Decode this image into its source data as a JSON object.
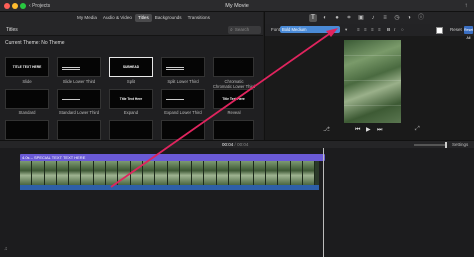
{
  "window": {
    "title": "My Movie",
    "projects_label": "Projects"
  },
  "browser": {
    "tabs": [
      {
        "label": "My Media"
      },
      {
        "label": "Audio & Video"
      },
      {
        "label": "Titles"
      },
      {
        "label": "Backgrounds"
      },
      {
        "label": "Transitions"
      }
    ],
    "active_tab": "Titles",
    "section_label": "Titles",
    "search_placeholder": "Search",
    "theme_label": "Current Theme: No Theme",
    "titles": [
      {
        "caption": "Slide",
        "thumb_text": "TITLE TEXT HERE"
      },
      {
        "caption": "Slide Lower Third",
        "thumb_text": ""
      },
      {
        "caption": "Split",
        "thumb_text": "SUBHEAD"
      },
      {
        "caption": "Split Lower Third",
        "thumb_text": ""
      },
      {
        "caption": "Chromatic",
        "thumb_text": ""
      },
      {
        "caption": "Chromatic Lower Third",
        "thumb_text": ""
      },
      {
        "caption": "Standard",
        "thumb_text": ""
      },
      {
        "caption": "Standard Lower Third",
        "thumb_text": ""
      },
      {
        "caption": "Expand",
        "thumb_text": "Title Text Here"
      },
      {
        "caption": "Expand Lower Third",
        "thumb_text": ""
      },
      {
        "caption": "Reveal",
        "thumb_text": "Title Text Here"
      },
      {
        "caption": "Reveal Lower Third",
        "thumb_text": ""
      },
      {
        "caption": "",
        "thumb_text": ""
      },
      {
        "caption": "",
        "thumb_text": ""
      },
      {
        "caption": "",
        "thumb_text": ""
      },
      {
        "caption": "",
        "thumb_text": ""
      },
      {
        "caption": "",
        "thumb_text": ""
      }
    ]
  },
  "viewer": {
    "font_label": "Font:",
    "font_value": "Bold Medium",
    "text_color": "#ffffff",
    "reset_label": "Reset",
    "reset_all_label": "Reset All"
  },
  "timeline": {
    "current_time": "00:04",
    "separator": "/",
    "total_time": "00:04",
    "settings_label": "Settings",
    "title_clip_label": "4.0s – SPECIAL TEXT TEXT HERE"
  },
  "colors": {
    "title_clip": "#6a5ad6",
    "audio_clip": "#2d5fa8",
    "annotation_arrow": "#e0245e",
    "font_select": "#4a8ad6"
  }
}
